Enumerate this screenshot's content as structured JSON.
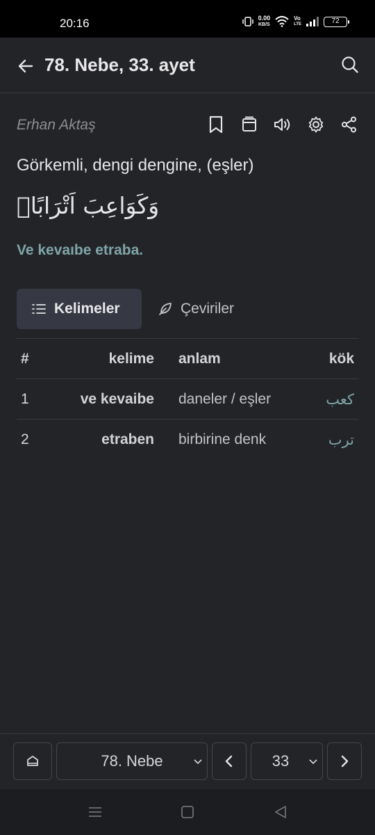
{
  "status_bar": {
    "time": "20:16",
    "net_speed": "0.00",
    "net_unit": "KB/S",
    "volte_top": "Vo",
    "volte_bottom": "LTE",
    "battery": "72"
  },
  "header": {
    "title": "78. Nebe, 33. ayet",
    "back_icon": "arrow-left-icon",
    "search_icon": "search-icon"
  },
  "verse": {
    "translator": "Erhan Aktaş",
    "translation": "Görkemli, dengi dengine, (eşler)",
    "arabic": "وَكَوَاعِبَ اَتْرَابًاۙ",
    "transliteration": "Ve kevaıbe etraba."
  },
  "actions": [
    "bookmark-icon",
    "book-icon",
    "speaker-icon",
    "settings-icon",
    "share-icon"
  ],
  "tabs": [
    {
      "label": "Kelimeler",
      "icon": "list-icon",
      "active": true
    },
    {
      "label": "Çeviriler",
      "icon": "feather-icon",
      "active": false
    }
  ],
  "table": {
    "headers": {
      "num": "#",
      "word": "kelime",
      "meaning": "anlam",
      "root": "kök"
    },
    "rows": [
      {
        "num": "1",
        "word": "ve kevaibe",
        "meaning": "daneler / eşler",
        "root": "كعب"
      },
      {
        "num": "2",
        "word": "etraben",
        "meaning": "birbirine denk",
        "root": "ترب"
      }
    ]
  },
  "bottom_nav": {
    "home_icon": "home-icon",
    "surah": "78. Nebe",
    "prev_icon": "chevron-left-icon",
    "ayah": "33",
    "next_icon": "chevron-right-icon"
  },
  "colors": {
    "background": "#232427",
    "accent": "#7fa5a9",
    "active_tab": "#363844"
  }
}
